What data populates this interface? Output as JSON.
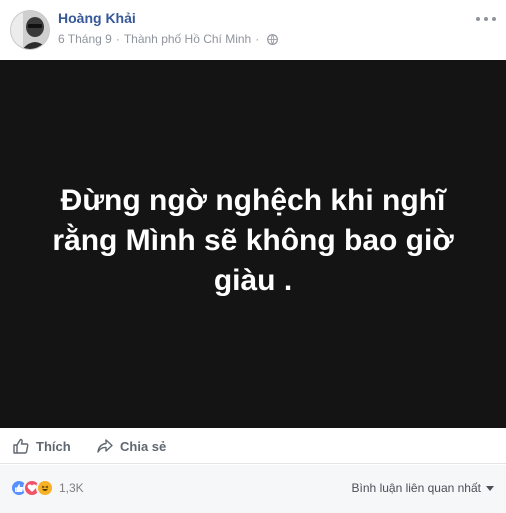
{
  "post": {
    "author": "Hoàng Khải",
    "date": "6 Tháng 9",
    "separator": "·",
    "location": "Thành phố Hồ Chí Minh",
    "separator2": "·",
    "privacy_icon": "globe-icon",
    "media_text": "Đừng ngờ nghệch khi nghĩ rằng Mình sẽ không bao giờ giàu ."
  },
  "actions": {
    "like_label": "Thích",
    "share_label": "Chia sẻ"
  },
  "reactions": {
    "icons": [
      "like-icon",
      "love-icon",
      "haha-icon"
    ],
    "count": "1,3K"
  },
  "comments": {
    "sort_label": "Bình luận liên quan nhất"
  },
  "colors": {
    "author": "#365899",
    "media_bg": "#141414",
    "meta": "#90949c",
    "like": "#5890ff",
    "love": "#f25268",
    "haha": "#f7b125"
  }
}
